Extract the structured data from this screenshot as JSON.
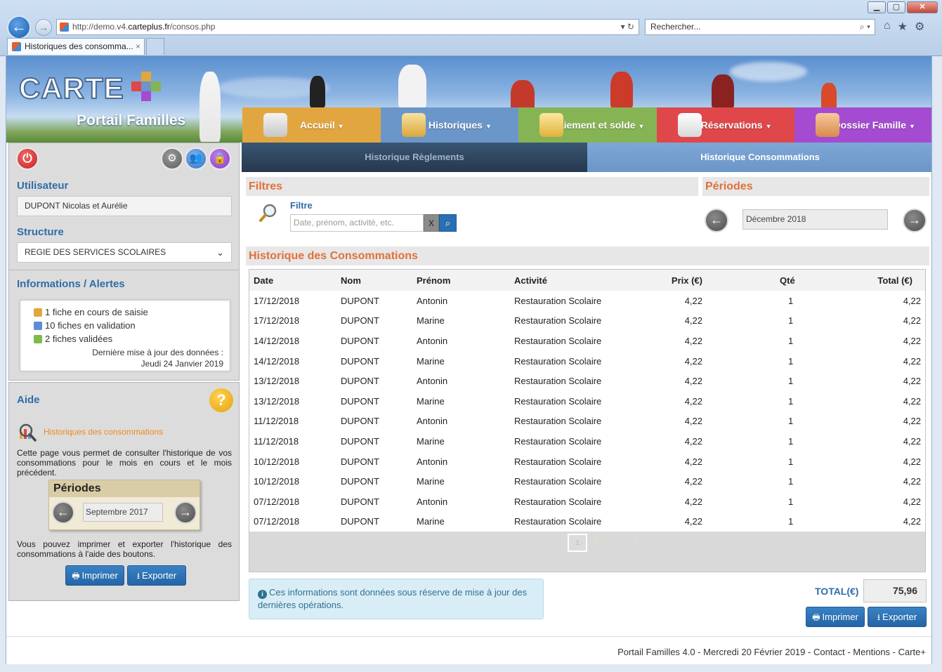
{
  "browser": {
    "url_prefix": "http://demo.v4.",
    "url_domain": "carteplus.fr",
    "url_path": "/consos.php",
    "search_placeholder": "Rechercher...",
    "tab_title": "Historiques des consomma...",
    "tab_close": "×"
  },
  "header": {
    "logo_text": "CARTE",
    "portal_title": "Portail Familles"
  },
  "main_nav": [
    {
      "label": "Accueil",
      "color": "#e2a640"
    },
    {
      "label": "Historiques",
      "color": "#6b96c9"
    },
    {
      "label": "Paiement et solde",
      "color": "#86b454"
    },
    {
      "label": "Réservations",
      "color": "#e0474b"
    },
    {
      "label": "Dossier Famille",
      "color": "#a54bd1"
    }
  ],
  "sidebar": {
    "user_title": "Utilisateur",
    "user_value": "DUPONT Nicolas et Aurélie",
    "structure_title": "Structure",
    "structure_value": "REGIE DES SERVICES SCOLAIRES",
    "alerts_title": "Informations / Alertes",
    "alerts": [
      {
        "text": "1 fiche en cours de saisie",
        "color": "#e2a640"
      },
      {
        "text": "10 fiches en validation",
        "color": "#5b8ed6"
      },
      {
        "text": "2 fiches validées",
        "color": "#7dba4a"
      }
    ],
    "update_label": "Dernière mise à jour des données :",
    "update_date": "Jeudi 24 Janvier 2019",
    "help_title": "Aide",
    "help_sub": "Historiques des consommations",
    "help_text1": "Cette page vous permet de consulter l'historique de vos consommations pour le mois en cours et le mois précédent.",
    "help_periode_title": "Périodes",
    "help_periode_value": "Septembre 2017",
    "help_text2": "Vous pouvez imprimer et exporter l'historique des consommations à l'aide des boutons.",
    "print_label": "Imprimer",
    "export_label": "Exporter"
  },
  "subtabs": {
    "reglements": "Historique Règlements",
    "consommations": "Historique Consommations"
  },
  "filters": {
    "title": "Filtres",
    "label": "Filtre",
    "placeholder": "Date, prénom, activité, etc.",
    "clear": "X"
  },
  "periods": {
    "title": "Périodes",
    "value": "Décembre 2018"
  },
  "history": {
    "title": "Historique des Consommations",
    "columns": [
      "Date",
      "Nom",
      "Prénom",
      "Activité",
      "Prix (€)",
      "Qté",
      "Total (€)"
    ],
    "rows": [
      [
        "17/12/2018",
        "DUPONT",
        "Antonin",
        "Restauration Scolaire",
        "4,22",
        "1",
        "4,22"
      ],
      [
        "17/12/2018",
        "DUPONT",
        "Marine",
        "Restauration Scolaire",
        "4,22",
        "1",
        "4,22"
      ],
      [
        "14/12/2018",
        "DUPONT",
        "Antonin",
        "Restauration Scolaire",
        "4,22",
        "1",
        "4,22"
      ],
      [
        "14/12/2018",
        "DUPONT",
        "Marine",
        "Restauration Scolaire",
        "4,22",
        "1",
        "4,22"
      ],
      [
        "13/12/2018",
        "DUPONT",
        "Antonin",
        "Restauration Scolaire",
        "4,22",
        "1",
        "4,22"
      ],
      [
        "13/12/2018",
        "DUPONT",
        "Marine",
        "Restauration Scolaire",
        "4,22",
        "1",
        "4,22"
      ],
      [
        "11/12/2018",
        "DUPONT",
        "Antonin",
        "Restauration Scolaire",
        "4,22",
        "1",
        "4,22"
      ],
      [
        "11/12/2018",
        "DUPONT",
        "Marine",
        "Restauration Scolaire",
        "4,22",
        "1",
        "4,22"
      ],
      [
        "10/12/2018",
        "DUPONT",
        "Antonin",
        "Restauration Scolaire",
        "4,22",
        "1",
        "4,22"
      ],
      [
        "10/12/2018",
        "DUPONT",
        "Marine",
        "Restauration Scolaire",
        "4,22",
        "1",
        "4,22"
      ],
      [
        "07/12/2018",
        "DUPONT",
        "Antonin",
        "Restauration Scolaire",
        "4,22",
        "1",
        "4,22"
      ],
      [
        "07/12/2018",
        "DUPONT",
        "Marine",
        "Restauration Scolaire",
        "4,22",
        "1",
        "4,22"
      ]
    ],
    "pages": [
      "1",
      "2",
      "›",
      "»"
    ],
    "current_page": "1"
  },
  "info_text": "Ces informations sont données sous réserve de mise à jour des dernières opérations.",
  "total": {
    "label": "TOTAL(€)",
    "value": "75,96"
  },
  "actions": {
    "print": "Imprimer",
    "export": "Exporter"
  },
  "footer": "Portail Familles 4.0 - Mercredi 20 Février 2019 - Contact - Mentions - Carte+"
}
